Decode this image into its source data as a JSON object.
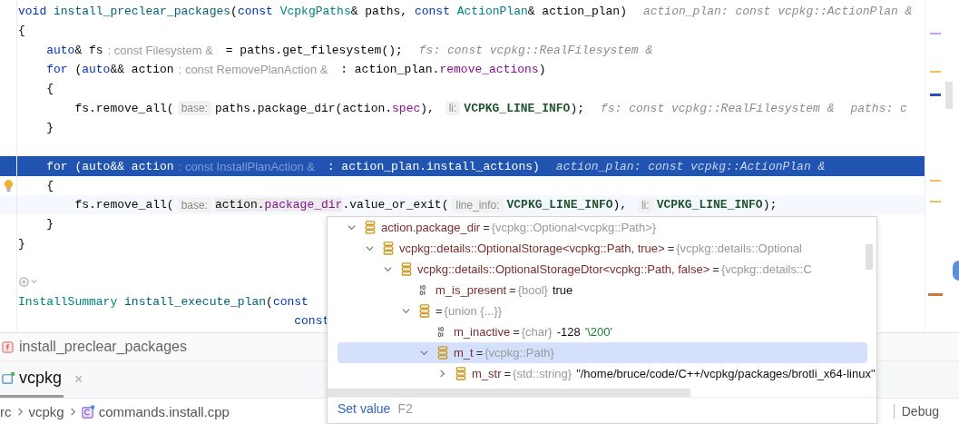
{
  "editor": {
    "lines": [
      {
        "kind": "code",
        "segments": [
          {
            "kind": "kw",
            "text": "void "
          },
          {
            "kind": "fn",
            "text": "install_preclear_packages"
          },
          {
            "kind": "plain",
            "text": "("
          },
          {
            "kind": "kw",
            "text": "const "
          },
          {
            "kind": "type",
            "text": "VcpkgPaths"
          },
          {
            "kind": "plain",
            "text": "& paths, "
          },
          {
            "kind": "kw",
            "text": "const "
          },
          {
            "kind": "type",
            "text": "ActionPlan"
          },
          {
            "kind": "plain",
            "text": "& action_plan)"
          },
          {
            "kind": "eol",
            "text": "action_plan: const vcpkg::ActionPlan &"
          }
        ]
      },
      {
        "kind": "code",
        "segments": [
          {
            "kind": "plain",
            "text": "{"
          }
        ]
      },
      {
        "kind": "code",
        "segments": [
          {
            "kind": "kw",
            "text": "    auto"
          },
          {
            "kind": "plain",
            "text": "& fs"
          },
          {
            "kind": "typehint",
            "text": ": const Filesystem &"
          },
          {
            "kind": "plain",
            "text": " = paths.get_filesystem();"
          },
          {
            "kind": "eol",
            "text": "fs: const vcpkg::RealFilesystem &"
          }
        ]
      },
      {
        "kind": "code",
        "segments": [
          {
            "kind": "kw",
            "text": "    for"
          },
          {
            "kind": "plain",
            "text": " ("
          },
          {
            "kind": "kw",
            "text": "auto"
          },
          {
            "kind": "plain",
            "text": "&& action"
          },
          {
            "kind": "typehint",
            "text": ": const RemovePlanAction &"
          },
          {
            "kind": "plain",
            "text": " : action_plan."
          },
          {
            "kind": "member",
            "text": "remove_actions"
          },
          {
            "kind": "plain",
            "text": ")"
          }
        ]
      },
      {
        "kind": "code",
        "segments": [
          {
            "kind": "plain",
            "text": "    {"
          }
        ]
      },
      {
        "kind": "code",
        "segments": [
          {
            "kind": "plain",
            "text": "        fs.remove_all("
          },
          {
            "kind": "param",
            "text": "base:"
          },
          {
            "kind": "plain",
            "text": "paths.package_dir(action."
          },
          {
            "kind": "member",
            "text": "spec"
          },
          {
            "kind": "plain",
            "text": "), "
          },
          {
            "kind": "param",
            "text": "li:"
          },
          {
            "kind": "macro",
            "text": "VCPKG_LINE_INFO"
          },
          {
            "kind": "plain",
            "text": ");"
          },
          {
            "kind": "eol",
            "text": "fs: const vcpkg::RealFilesystem &"
          },
          {
            "kind": "eol",
            "text": "paths: c"
          }
        ]
      },
      {
        "kind": "code",
        "segments": [
          {
            "kind": "plain",
            "text": "    }"
          }
        ]
      },
      {
        "kind": "blank"
      },
      {
        "kind": "execution",
        "segments": [
          {
            "kind": "kw",
            "text": "    for"
          },
          {
            "kind": "plain",
            "text": " ("
          },
          {
            "kind": "kw",
            "text": "auto"
          },
          {
            "kind": "plain",
            "text": "&& action"
          },
          {
            "kind": "typehint",
            "text": ": const InstallPlanAction &"
          },
          {
            "kind": "plain",
            "text": " : action_plan."
          },
          {
            "kind": "member",
            "text": "install_actions"
          },
          {
            "kind": "plain",
            "text": ")"
          },
          {
            "kind": "eol",
            "text": "action_plan: const vcpkg::ActionPlan &"
          }
        ]
      },
      {
        "kind": "bulb",
        "segments": [
          {
            "kind": "plain",
            "text": "    {"
          }
        ]
      },
      {
        "kind": "caret",
        "segments": [
          {
            "kind": "plain",
            "text": "        fs.remove_all("
          },
          {
            "kind": "param",
            "text": "base:"
          },
          {
            "kind": "selected",
            "text": "action."
          },
          {
            "kind": "selected_member",
            "text": "package_dir"
          },
          {
            "kind": "plain",
            "text": ".value_or_exit("
          },
          {
            "kind": "param",
            "text": "line_info:"
          },
          {
            "kind": "macro",
            "text": "VCPKG_LINE_INFO"
          },
          {
            "kind": "plain",
            "text": "), "
          },
          {
            "kind": "param",
            "text": "li:"
          },
          {
            "kind": "macro",
            "text": "VCPKG_LINE_INFO"
          },
          {
            "kind": "plain",
            "text": ");"
          }
        ]
      },
      {
        "kind": "code",
        "segments": [
          {
            "kind": "plain",
            "text": "    }"
          }
        ]
      },
      {
        "kind": "code",
        "segments": [
          {
            "kind": "plain",
            "text": "}"
          }
        ]
      },
      {
        "kind": "blank"
      },
      {
        "kind": "vision"
      },
      {
        "kind": "code",
        "segments": [
          {
            "kind": "type",
            "text": "InstallSummary "
          },
          {
            "kind": "fn",
            "text": "install_execute_plan"
          },
          {
            "kind": "plain",
            "text": "("
          },
          {
            "kind": "kw",
            "text": "const"
          }
        ]
      },
      {
        "kind": "code",
        "segments": [
          {
            "kind": "kw",
            "text": "                                       const"
          }
        ]
      }
    ]
  },
  "breadcrumb": {
    "function": "install_preclear_packages"
  },
  "tool_tabs": [
    {
      "label": "vcpkg",
      "selected": true,
      "close": "×"
    }
  ],
  "path_bar": {
    "items": [
      {
        "kind": "text",
        "text": "rc"
      },
      {
        "kind": "text",
        "text": "vcpkg"
      },
      {
        "kind": "file",
        "text": "commands.install.cpp"
      }
    ],
    "right": "Debug"
  },
  "variables_popup": {
    "nodes": [
      {
        "name": "action.package_dir",
        "sep": "=",
        "type": "{vcpkg::Optional<vcpkg::Path>}",
        "kind": "struct",
        "expanded": true,
        "selected": false,
        "children": [
          {
            "name": "vcpkg::details::OptionalStorage<vcpkg::Path, true>",
            "sep": "=",
            "type": "{vcpkg::details::Optional",
            "kind": "struct",
            "expanded": true,
            "selected": false,
            "children": [
              {
                "name": "vcpkg::details::OptionalStorageDtor<vcpkg::Path, false>",
                "sep": "=",
                "type": "{vcpkg::details::C",
                "kind": "struct",
                "expanded": true,
                "selected": false,
                "children": [
                  {
                    "name": "m_is_present",
                    "sep": "=",
                    "type": "{bool}",
                    "value": "true",
                    "kind": "primitive",
                    "selected": false
                  },
                  {
                    "sep": "=",
                    "type": "{union {...}}",
                    "kind": "struct",
                    "expanded": true,
                    "selected": false,
                    "children": [
                      {
                        "name": "m_inactive",
                        "sep": "=",
                        "type": "{char}",
                        "value": "-128",
                        "char_value": "'\\200'",
                        "kind": "primitive",
                        "selected": false
                      },
                      {
                        "name": "m_t",
                        "sep": "=",
                        "type": "{vcpkg::Path}",
                        "kind": "struct",
                        "expanded": true,
                        "selected": true,
                        "children": [
                          {
                            "name": "m_str",
                            "sep": "=",
                            "type": "{std::string}",
                            "value": "\"/home/bruce/code/C++/vcpkg/packages/brotli_x64-linux\"",
                            "kind": "struct",
                            "expanded": false,
                            "selected": false
                          }
                        ]
                      }
                    ]
                  }
                ]
              }
            ]
          }
        ]
      }
    ],
    "action": {
      "label": "Set value",
      "shortcut": "F2"
    }
  }
}
